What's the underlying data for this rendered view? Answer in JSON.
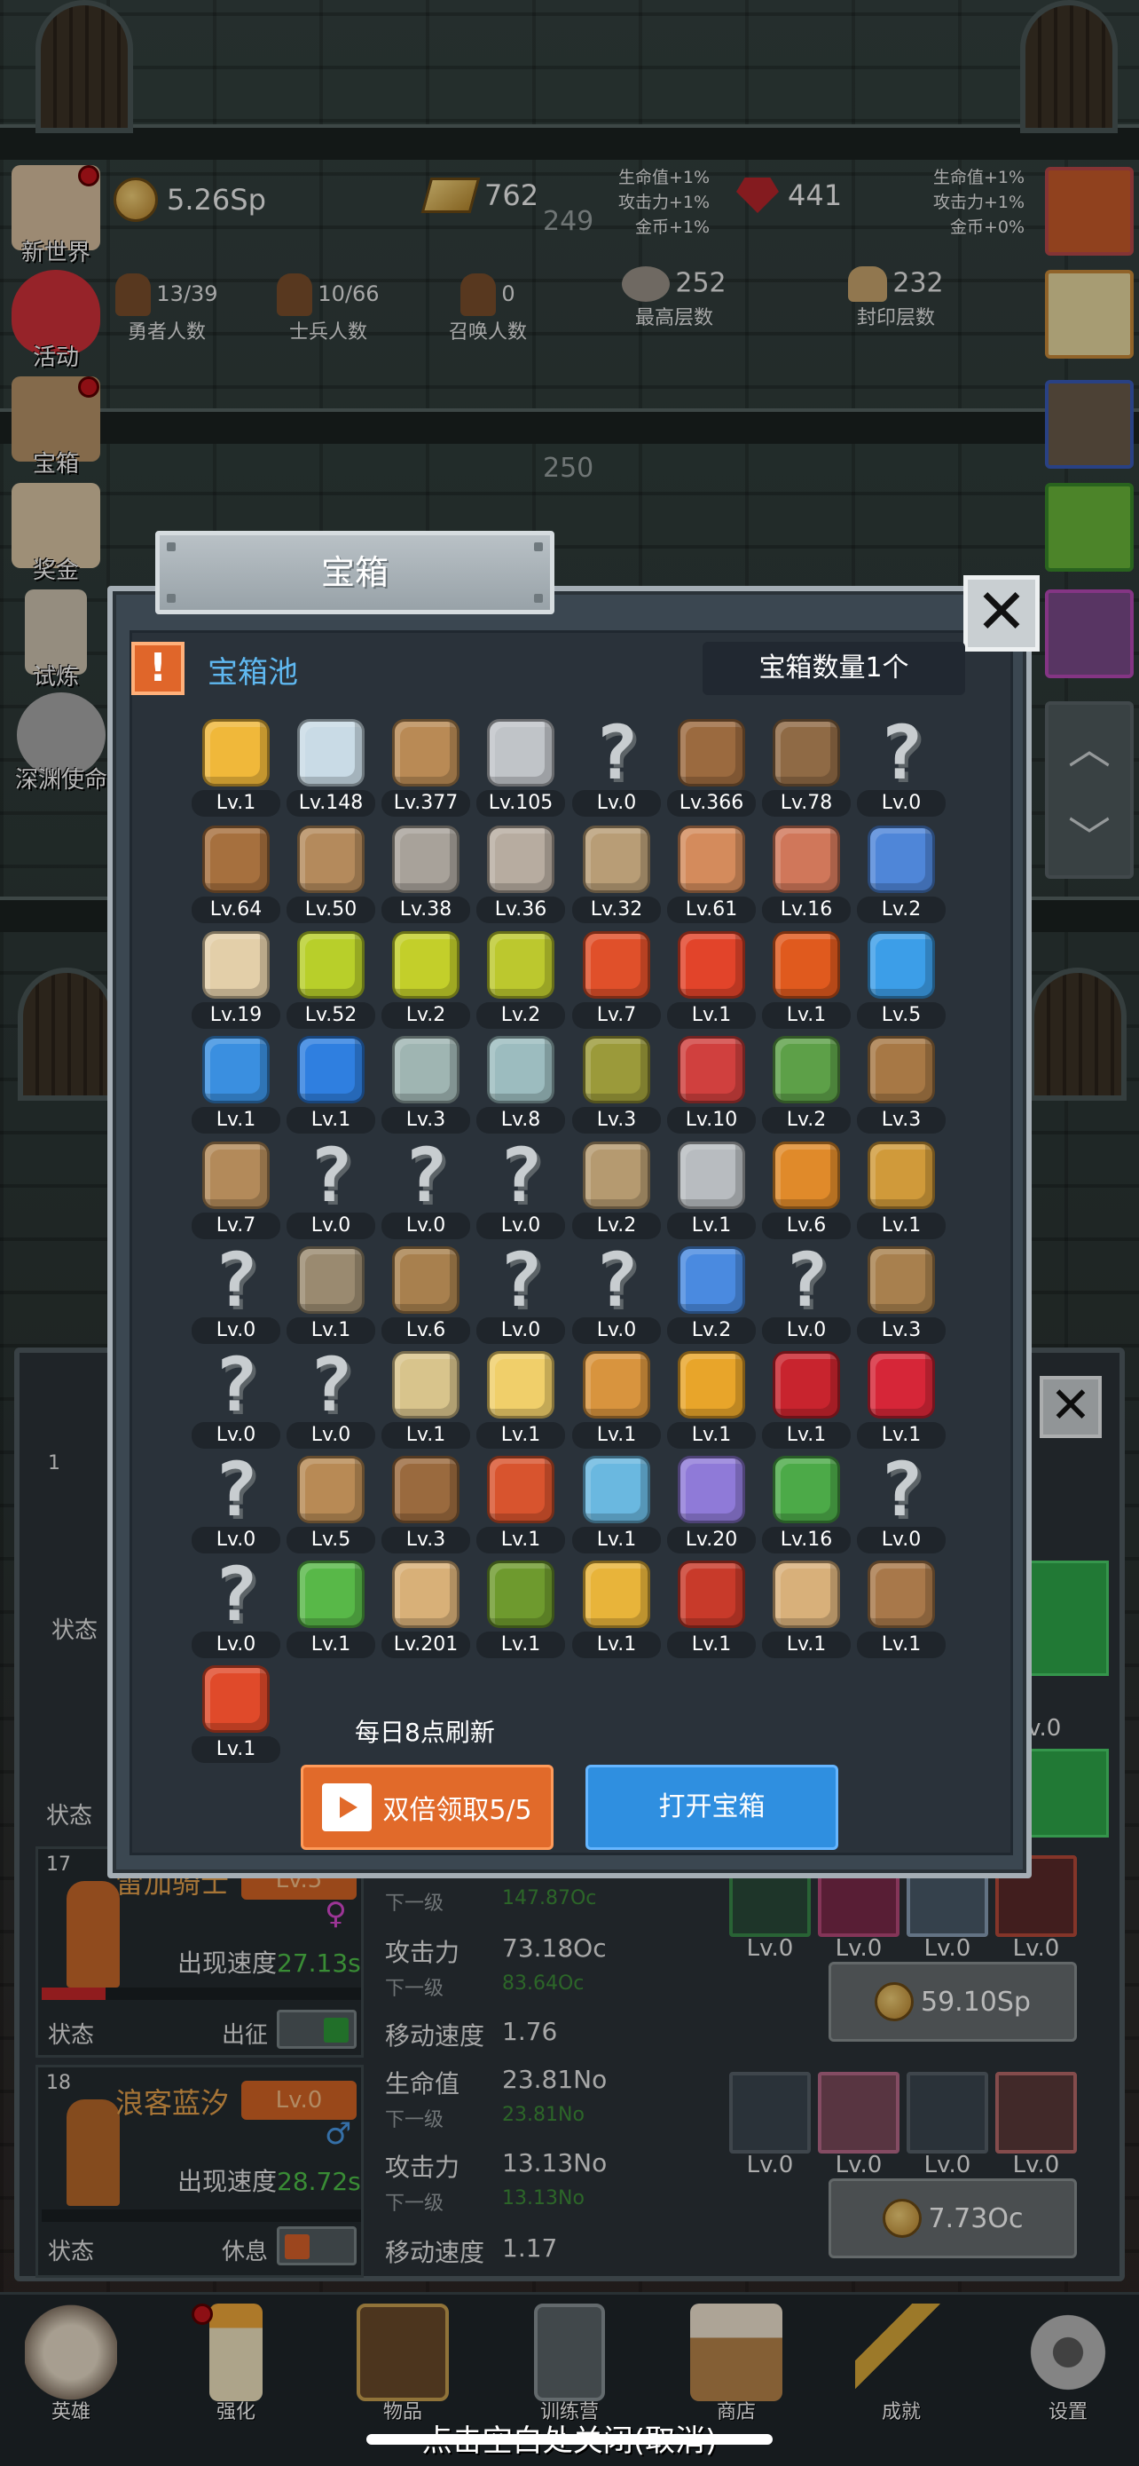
{
  "resources": {
    "gold": "5.26Sp",
    "gold_bars": "762",
    "gems": "441",
    "bonus_left": [
      "生命值+1%",
      "攻击力+1%",
      "金币+1%"
    ],
    "bonus_right": [
      "生命值+1%",
      "攻击力+1%",
      "金币+0%"
    ]
  },
  "stats": [
    {
      "value": "13/39",
      "label": "勇者人数"
    },
    {
      "value": "10/66",
      "label": "士兵人数"
    },
    {
      "value": "0",
      "label": "召唤人数"
    },
    {
      "value": "252",
      "label": "最高层数"
    },
    {
      "value": "232",
      "label": "封印层数"
    }
  ],
  "background_numbers": {
    "floor_a": "249",
    "floor_b": "250"
  },
  "side_menu": [
    "新世界",
    "活动",
    "宝箱",
    "奖金",
    "试炼",
    "深渊使命"
  ],
  "modal": {
    "title": "宝箱",
    "close": "✕",
    "pool_title": "宝箱池",
    "pool_alert": "!",
    "chest_count": "宝箱数量1个",
    "refresh_text": "每日8点刷新",
    "double_button": "双倍领取5/5",
    "open_button": "打开宝箱",
    "items": [
      {
        "icon": "crown-icon",
        "level": "Lv.1",
        "color": "#f0b83a"
      },
      {
        "icon": "diamond-icon",
        "level": "Lv.148",
        "color": "#c9dbe6"
      },
      {
        "icon": "sword-icon",
        "level": "Lv.377",
        "color": "#b98a55"
      },
      {
        "icon": "sword-icon",
        "level": "Lv.105",
        "color": "#c0c4c8"
      },
      {
        "icon": "unknown-icon",
        "level": "Lv.0",
        "color": "#c8cdd0"
      },
      {
        "icon": "armor-icon",
        "level": "Lv.366",
        "color": "#9b6a3f"
      },
      {
        "icon": "vest-icon",
        "level": "Lv.78",
        "color": "#8f6a45"
      },
      {
        "icon": "unknown-icon",
        "level": "Lv.0",
        "color": "#c8cdd0"
      },
      {
        "icon": "helmet-icon",
        "level": "Lv.64",
        "color": "#a6703e"
      },
      {
        "icon": "dagger-icon",
        "level": "Lv.50",
        "color": "#b48a5c"
      },
      {
        "icon": "knight-helmet-icon",
        "level": "Lv.38",
        "color": "#a8a29a"
      },
      {
        "icon": "hammer-icon",
        "level": "Lv.36",
        "color": "#b7aca0"
      },
      {
        "icon": "great-helm-icon",
        "level": "Lv.32",
        "color": "#b89d76"
      },
      {
        "icon": "ham-icon",
        "level": "Lv.61",
        "color": "#d48b5c"
      },
      {
        "icon": "steak-icon",
        "level": "Lv.16",
        "color": "#d0775a"
      },
      {
        "icon": "sack-icon",
        "level": "Lv.2",
        "color": "#4f86d8"
      },
      {
        "icon": "flour-icon",
        "level": "Lv.19",
        "color": "#e3cfa9"
      },
      {
        "icon": "potion-icon",
        "level": "Lv.52",
        "color": "#b8cf2a"
      },
      {
        "icon": "potion-icon",
        "level": "Lv.2",
        "color": "#c3cf2a"
      },
      {
        "icon": "potion-icon",
        "level": "Lv.2",
        "color": "#bcc82e"
      },
      {
        "icon": "potion-icon",
        "level": "Lv.7",
        "color": "#e0502a"
      },
      {
        "icon": "potion-icon",
        "level": "Lv.1",
        "color": "#e2442a"
      },
      {
        "icon": "potion-icon",
        "level": "Lv.1",
        "color": "#e05a1e"
      },
      {
        "icon": "potion-icon",
        "level": "Lv.5",
        "color": "#3c9ee8"
      },
      {
        "icon": "potion-icon",
        "level": "Lv.1",
        "color": "#3a8fe0"
      },
      {
        "icon": "potion-icon",
        "level": "Lv.1",
        "color": "#2f7fe0"
      },
      {
        "icon": "bottle-icon",
        "level": "Lv.3",
        "color": "#9fb5b2"
      },
      {
        "icon": "bottle-icon",
        "level": "Lv.8",
        "color": "#9cbcbf"
      },
      {
        "icon": "wine-bottle-icon",
        "level": "Lv.3",
        "color": "#9b9a3a"
      },
      {
        "icon": "wine-bottle-icon",
        "level": "Lv.10",
        "color": "#d0403e"
      },
      {
        "icon": "winged-boot-icon",
        "level": "Lv.2",
        "color": "#5da048"
      },
      {
        "icon": "boot-icon",
        "level": "Lv.3",
        "color": "#a77845"
      },
      {
        "icon": "boot-icon",
        "level": "Lv.7",
        "color": "#b38a5a"
      },
      {
        "icon": "unknown-icon",
        "level": "Lv.0",
        "color": "#c8cdd0"
      },
      {
        "icon": "unknown-icon",
        "level": "Lv.0",
        "color": "#c8cdd0"
      },
      {
        "icon": "unknown-icon",
        "level": "Lv.0",
        "color": "#c8cdd0"
      },
      {
        "icon": "shield-icon",
        "level": "Lv.2",
        "color": "#b59a70"
      },
      {
        "icon": "sword-icon",
        "level": "Lv.1",
        "color": "#b8bcc0"
      },
      {
        "icon": "torch-icon",
        "level": "Lv.6",
        "color": "#e08a2a"
      },
      {
        "icon": "torch-icon",
        "level": "Lv.1",
        "color": "#d09a3a"
      },
      {
        "icon": "unknown-icon",
        "level": "Lv.0",
        "color": "#c8cdd0"
      },
      {
        "icon": "pickaxe-icon",
        "level": "Lv.1",
        "color": "#9a8a70"
      },
      {
        "icon": "staff-icon",
        "level": "Lv.6",
        "color": "#a8804e"
      },
      {
        "icon": "unknown-icon",
        "level": "Lv.0",
        "color": "#c8cdd0"
      },
      {
        "icon": "unknown-icon",
        "level": "Lv.0",
        "color": "#c8cdd0"
      },
      {
        "icon": "wand-icon",
        "level": "Lv.2",
        "color": "#4a8ae0"
      },
      {
        "icon": "unknown-icon",
        "level": "Lv.0",
        "color": "#c8cdd0"
      },
      {
        "icon": "backpack-icon",
        "level": "Lv.3",
        "color": "#a8804e"
      },
      {
        "icon": "unknown-icon",
        "level": "Lv.0",
        "color": "#c8cdd0"
      },
      {
        "icon": "unknown-icon",
        "level": "Lv.0",
        "color": "#c8cdd0"
      },
      {
        "icon": "bone-club-icon",
        "level": "Lv.1",
        "color": "#d8c48c"
      },
      {
        "icon": "cheese-icon",
        "level": "Lv.1",
        "color": "#f0cf6a"
      },
      {
        "icon": "pie-icon",
        "level": "Lv.1",
        "color": "#d8943e"
      },
      {
        "icon": "honey-jar-icon",
        "level": "Lv.1",
        "color": "#e8a52a"
      },
      {
        "icon": "red-crystal-icon",
        "level": "Lv.1",
        "color": "#c8242e"
      },
      {
        "icon": "ruby-orb-icon",
        "level": "Lv.1",
        "color": "#d62638"
      },
      {
        "icon": "unknown-icon",
        "level": "Lv.0",
        "color": "#c8cdd0"
      },
      {
        "icon": "bow-icon",
        "level": "Lv.5",
        "color": "#b88a55"
      },
      {
        "icon": "crossbow-icon",
        "level": "Lv.3",
        "color": "#9a6a3e"
      },
      {
        "icon": "rune-shield-icon",
        "level": "Lv.1",
        "color": "#d8542e"
      },
      {
        "icon": "frost-ghost-icon",
        "level": "Lv.1",
        "color": "#6ab8e0"
      },
      {
        "icon": "spirit-icon",
        "level": "Lv.20",
        "color": "#8f7ad8"
      },
      {
        "icon": "emblem-icon",
        "level": "Lv.16",
        "color": "#4caa48"
      },
      {
        "icon": "unknown-icon",
        "level": "Lv.0",
        "color": "#c8cdd0"
      },
      {
        "icon": "unknown-icon",
        "level": "Lv.0",
        "color": "#c8cdd0"
      },
      {
        "icon": "scepter-icon",
        "level": "Lv.1",
        "color": "#58b848"
      },
      {
        "icon": "beer-mug-icon",
        "level": "Lv.201",
        "color": "#d8b078"
      },
      {
        "icon": "vine-icon",
        "level": "Lv.1",
        "color": "#6e9a2e"
      },
      {
        "icon": "golden-pickaxe-icon",
        "level": "Lv.1",
        "color": "#e8b43a"
      },
      {
        "icon": "spell-book-icon",
        "level": "Lv.1",
        "color": "#c83a2a"
      },
      {
        "icon": "scroll-icon",
        "level": "Lv.1",
        "color": "#d8b07a"
      },
      {
        "icon": "whip-icon",
        "level": "Lv.1",
        "color": "#a8784a"
      },
      {
        "icon": "card-icon",
        "level": "Lv.1",
        "color": "#e04a2a"
      }
    ]
  },
  "heroes": [
    {
      "index": "17",
      "name": "雷加骑士",
      "level": "Lv.5",
      "speed_label": "出现速度",
      "speed": "27.13s",
      "gender": "♀",
      "status_label": "状态",
      "mode": "出征",
      "stats": [
        {
          "label": "下一级",
          "value": "147.87Oc"
        },
        {
          "label": "攻击力",
          "value": "73.18Oc"
        },
        {
          "label": "下一级",
          "value": "83.64Oc"
        },
        {
          "label": "移动速度",
          "value": "1.76"
        }
      ],
      "equipment": [
        "Lv.0",
        "Lv.0",
        "Lv.0",
        "Lv.0"
      ],
      "cost": "59.10Sp"
    },
    {
      "index": "18",
      "name": "浪客蓝汐",
      "level": "Lv.0",
      "speed_label": "出现速度",
      "speed": "28.72s",
      "gender": "♂",
      "status_label": "状态",
      "mode": "休息",
      "stats": [
        {
          "label": "生命值",
          "value": "23.81No"
        },
        {
          "label": "下一级",
          "value": "23.81No"
        },
        {
          "label": "攻击力",
          "value": "13.13No"
        },
        {
          "label": "下一级",
          "value": "13.13No"
        },
        {
          "label": "移动速度",
          "value": "1.17"
        }
      ],
      "equipment": [
        "Lv.0",
        "Lv.0",
        "Lv.0",
        "Lv.0"
      ],
      "cost": "7.73Oc"
    }
  ],
  "partial_hero": {
    "index": "1",
    "status_label": "状态"
  },
  "partial_hero_2": {
    "status_label": "状态",
    "equip_level": "Lv.0"
  },
  "bottom_nav": [
    "英雄",
    "强化",
    "物品",
    "训练营",
    "商店",
    "成就",
    "设置"
  ],
  "hint": "点击空白处关闭(取消)"
}
